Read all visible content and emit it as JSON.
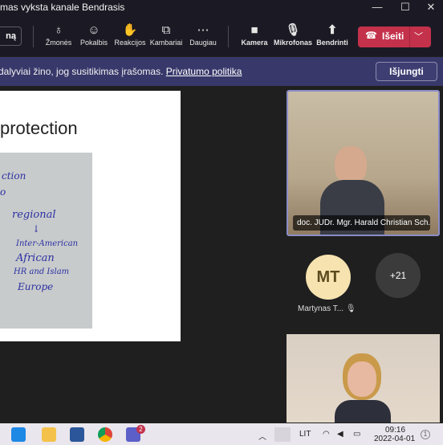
{
  "title_bar": {
    "title": "mas vyksta kanale Bendrasis",
    "controls": {
      "minimize": "—",
      "maximize": "☐",
      "close": "✕"
    }
  },
  "toolbar": {
    "left_button_label": "ną",
    "items": [
      {
        "id": "people",
        "label": "Žmonės",
        "icon": "people-icon",
        "glyph": "♁"
      },
      {
        "id": "chat",
        "label": "Pokalbis",
        "icon": "chat-icon",
        "glyph": "☺"
      },
      {
        "id": "reactions",
        "label": "Reakcijos",
        "icon": "reactions-icon",
        "glyph": "✋"
      },
      {
        "id": "rooms",
        "label": "Kambariai",
        "icon": "rooms-icon",
        "glyph": "⧉"
      },
      {
        "id": "more",
        "label": "Daugiau",
        "icon": "more-icon",
        "glyph": "⋯"
      },
      {
        "id": "camera",
        "label": "Kamera",
        "icon": "camera-icon",
        "glyph": "■"
      },
      {
        "id": "mic",
        "label": "Mikrofonas",
        "icon": "mic-off-icon",
        "glyph": "🎙"
      },
      {
        "id": "share",
        "label": "Bendrinti",
        "icon": "share-icon",
        "glyph": "⬆"
      }
    ],
    "leave": {
      "label": "Išeiti",
      "color": "#c4314b"
    }
  },
  "banner": {
    "message": "dalyviai žino, jog susitikimas įrašomas.",
    "link": "Privatumo politika",
    "dismiss": "Išjungti",
    "color": "#38386b"
  },
  "slide": {
    "heading": "protection",
    "handwriting": [
      "ction",
      "o",
      "regional",
      "↓",
      "Inter-American",
      "African",
      "HR and Islam",
      "Europe"
    ]
  },
  "participants": {
    "speaker_name": "doc. JUDr. Mgr. Harald Christian Sch...",
    "mt_initials": "MT",
    "mt_name": "Martynas T...",
    "more_count": "+21",
    "accent": "#8b8cc7"
  },
  "taskbar": {
    "lang": "LIT",
    "time": "09:16",
    "date": "2022-04-01",
    "notification_count": "1",
    "teams_badge": "2"
  }
}
